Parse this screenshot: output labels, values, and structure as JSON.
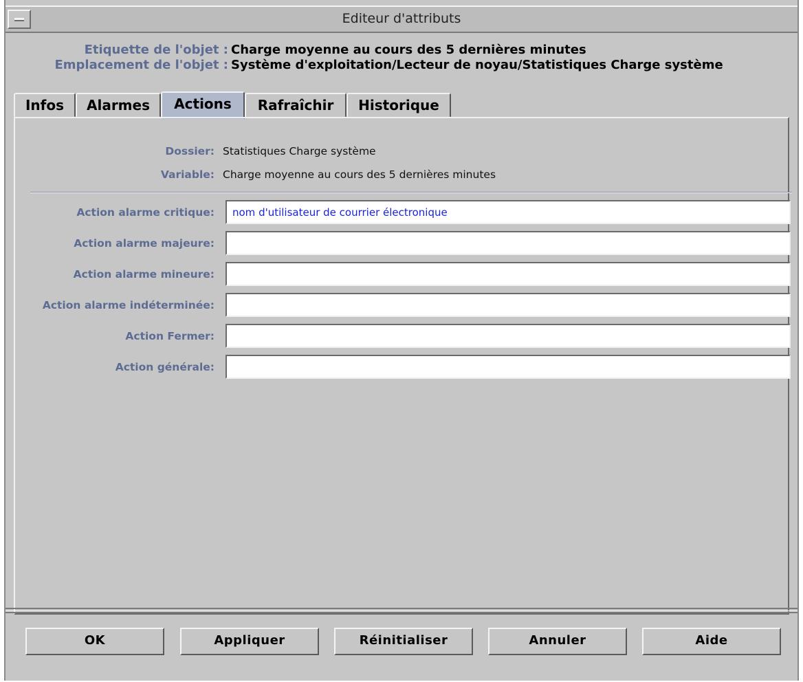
{
  "window": {
    "title": "Editeur d'attributs"
  },
  "header": {
    "label_name": "Etiquette de l'objet :",
    "value_name": "Charge moyenne au cours des 5 dernières minutes",
    "label_location": "Emplacement de l'objet :",
    "value_location": "Système d'exploitation/Lecteur de noyau/Statistiques Charge système"
  },
  "tabs": [
    "Infos",
    "Alarmes",
    "Actions",
    "Rafraîchir",
    "Historique"
  ],
  "active_tab": "Actions",
  "info": {
    "folder_label": "Dossier:",
    "folder_value": "Statistiques Charge système",
    "variable_label": "Variable:",
    "variable_value": "Charge moyenne au cours des 5 dernières minutes"
  },
  "actions": [
    {
      "label": "Action alarme critique:",
      "value": "nom d'utilisateur de courrier électronique"
    },
    {
      "label": "Action alarme majeure:",
      "value": ""
    },
    {
      "label": "Action alarme mineure:",
      "value": ""
    },
    {
      "label": "Action alarme indéterminée:",
      "value": ""
    },
    {
      "label": "Action Fermer:",
      "value": ""
    },
    {
      "label": "Action générale:",
      "value": ""
    }
  ],
  "buttons": {
    "ok": "OK",
    "apply": "Appliquer",
    "reset": "Réinitialiser",
    "cancel": "Annuler",
    "help": "Aide"
  },
  "colors": {
    "label": "#5d6c93",
    "background": "#c6c6c6",
    "active_tab": "#b0b8cc",
    "field_text": "#1a24d8"
  }
}
